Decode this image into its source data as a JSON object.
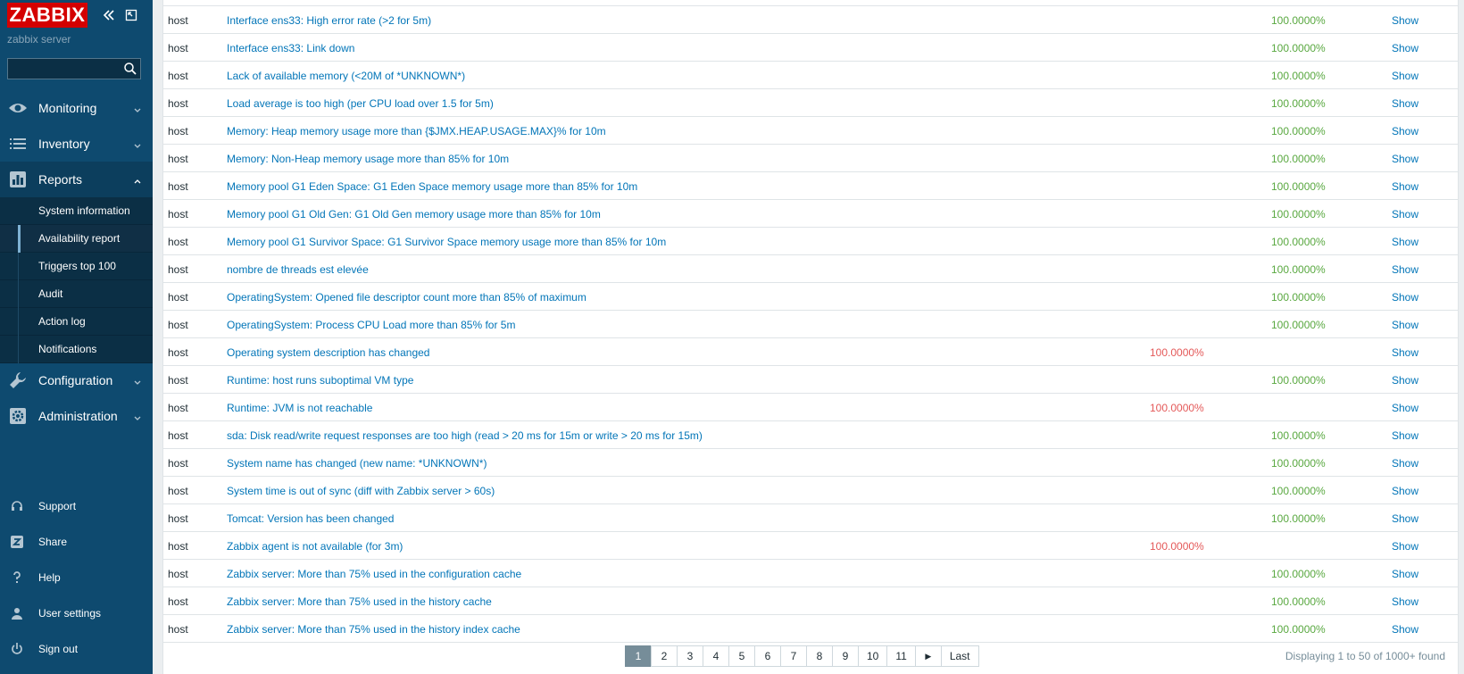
{
  "sidebar": {
    "logo": "ZABBIX",
    "server_name": "zabbix server",
    "search_placeholder": "",
    "nav": [
      {
        "label": "Monitoring",
        "icon": "eye-icon"
      },
      {
        "label": "Inventory",
        "icon": "list-icon"
      },
      {
        "label": "Reports",
        "icon": "chart-icon"
      },
      {
        "label": "Configuration",
        "icon": "wrench-icon"
      },
      {
        "label": "Administration",
        "icon": "gear-icon"
      }
    ],
    "reports_submenu": [
      "System information",
      "Availability report",
      "Triggers top 100",
      "Audit",
      "Action log",
      "Notifications"
    ],
    "bottom": [
      {
        "label": "Support",
        "icon": "headset-icon"
      },
      {
        "label": "Share",
        "icon": "share-icon"
      },
      {
        "label": "Help",
        "icon": "help-icon"
      },
      {
        "label": "User settings",
        "icon": "user-icon"
      },
      {
        "label": "Sign out",
        "icon": "power-icon"
      }
    ]
  },
  "rows": [
    {
      "host": "host",
      "name": "Interface ens33: High error rate (>2 for 5m)",
      "problems": "",
      "ok": "100.0000%",
      "graph": "Show"
    },
    {
      "host": "host",
      "name": "Interface ens33: Link down",
      "problems": "",
      "ok": "100.0000%",
      "graph": "Show"
    },
    {
      "host": "host",
      "name": "Lack of available memory (<20M of *UNKNOWN*)",
      "problems": "",
      "ok": "100.0000%",
      "graph": "Show"
    },
    {
      "host": "host",
      "name": "Load average is too high (per CPU load over 1.5 for 5m)",
      "problems": "",
      "ok": "100.0000%",
      "graph": "Show"
    },
    {
      "host": "host",
      "name": "Memory: Heap memory usage more than {$JMX.HEAP.USAGE.MAX}% for 10m",
      "problems": "",
      "ok": "100.0000%",
      "graph": "Show"
    },
    {
      "host": "host",
      "name": "Memory: Non-Heap memory usage more than 85% for 10m",
      "problems": "",
      "ok": "100.0000%",
      "graph": "Show"
    },
    {
      "host": "host",
      "name": "Memory pool G1 Eden Space: G1 Eden Space memory usage more than 85% for 10m",
      "problems": "",
      "ok": "100.0000%",
      "graph": "Show"
    },
    {
      "host": "host",
      "name": "Memory pool G1 Old Gen: G1 Old Gen memory usage more than 85% for 10m",
      "problems": "",
      "ok": "100.0000%",
      "graph": "Show"
    },
    {
      "host": "host",
      "name": "Memory pool G1 Survivor Space: G1 Survivor Space memory usage more than 85% for 10m",
      "problems": "",
      "ok": "100.0000%",
      "graph": "Show"
    },
    {
      "host": "host",
      "name": "nombre de threads est elevée",
      "problems": "",
      "ok": "100.0000%",
      "graph": "Show"
    },
    {
      "host": "host",
      "name": "OperatingSystem: Opened file descriptor count more than 85% of maximum",
      "problems": "",
      "ok": "100.0000%",
      "graph": "Show"
    },
    {
      "host": "host",
      "name": "OperatingSystem: Process CPU Load more than 85% for 5m",
      "problems": "",
      "ok": "100.0000%",
      "graph": "Show"
    },
    {
      "host": "host",
      "name": "Operating system description has changed",
      "problems": "100.0000%",
      "ok": "",
      "graph": "Show"
    },
    {
      "host": "host",
      "name": "Runtime: host runs suboptimal VM type",
      "problems": "",
      "ok": "100.0000%",
      "graph": "Show"
    },
    {
      "host": "host",
      "name": "Runtime: JVM is not reachable",
      "problems": "100.0000%",
      "ok": "",
      "graph": "Show"
    },
    {
      "host": "host",
      "name": "sda: Disk read/write request responses are too high (read > 20 ms for 15m or write > 20 ms for 15m)",
      "problems": "",
      "ok": "100.0000%",
      "graph": "Show"
    },
    {
      "host": "host",
      "name": "System name has changed (new name: *UNKNOWN*)",
      "problems": "",
      "ok": "100.0000%",
      "graph": "Show"
    },
    {
      "host": "host",
      "name": "System time is out of sync (diff with Zabbix server > 60s)",
      "problems": "",
      "ok": "100.0000%",
      "graph": "Show"
    },
    {
      "host": "host",
      "name": "Tomcat: Version has been changed",
      "problems": "",
      "ok": "100.0000%",
      "graph": "Show"
    },
    {
      "host": "host",
      "name": "Zabbix agent is not available (for 3m)",
      "problems": "100.0000%",
      "ok": "",
      "graph": "Show"
    },
    {
      "host": "host",
      "name": "Zabbix server: More than 75% used in the configuration cache",
      "problems": "",
      "ok": "100.0000%",
      "graph": "Show"
    },
    {
      "host": "host",
      "name": "Zabbix server: More than 75% used in the history cache",
      "problems": "",
      "ok": "100.0000%",
      "graph": "Show"
    },
    {
      "host": "host",
      "name": "Zabbix server: More than 75% used in the history index cache",
      "problems": "",
      "ok": "100.0000%",
      "graph": "Show"
    }
  ],
  "pager": {
    "pages": [
      "1",
      "2",
      "3",
      "4",
      "5",
      "6",
      "7",
      "8",
      "9",
      "10",
      "11"
    ],
    "current": "1",
    "next_arrow": "▶",
    "last": "Last"
  },
  "footer_info": "Displaying 1 to 50 of 1000+ found",
  "colors": {
    "sidebar": "#0e4a6f",
    "link": "#0275b8",
    "ok": "#59a840",
    "problem": "#e45959",
    "logo": "#d40000"
  }
}
